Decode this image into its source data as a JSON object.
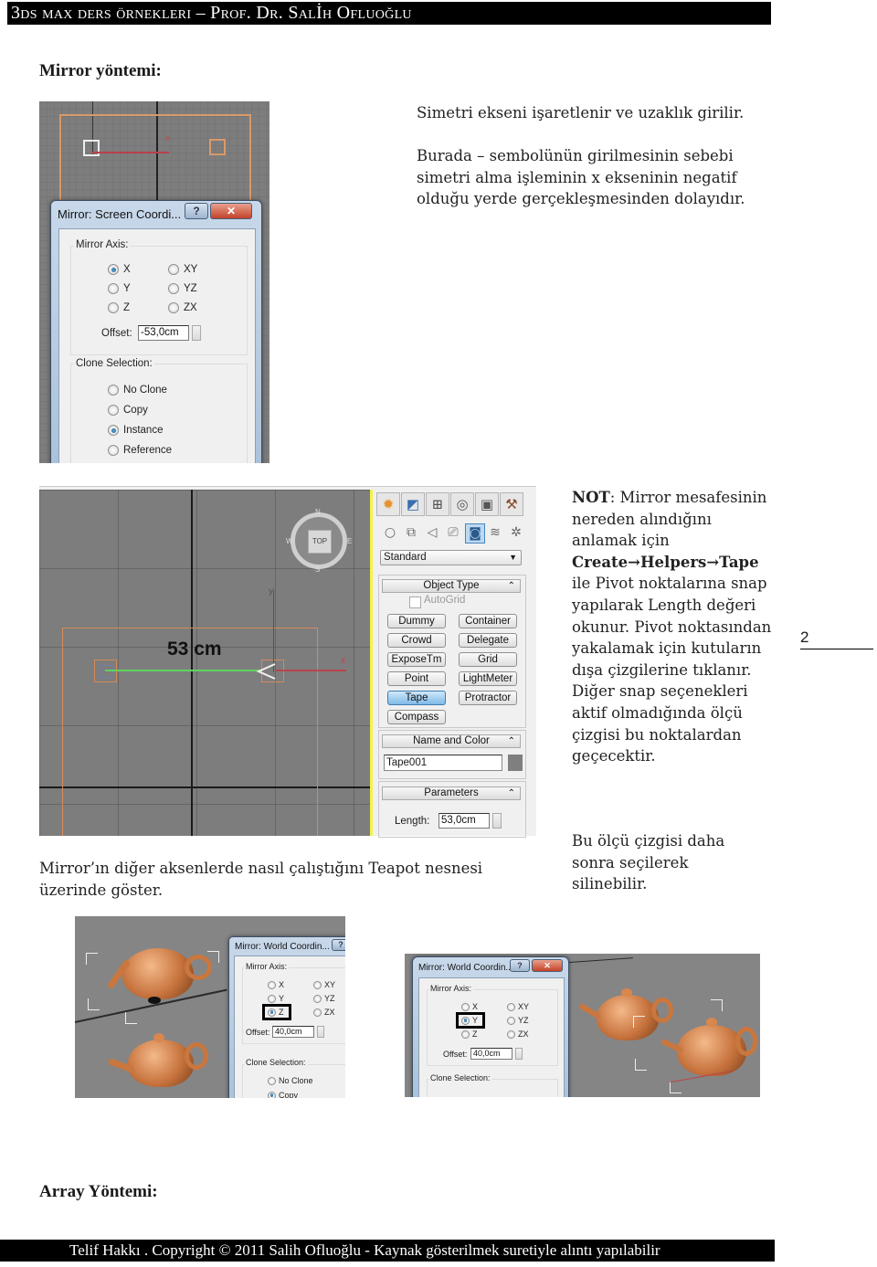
{
  "header": {
    "title": "3ds max ders örnekleri – Prof. Dr. Salİh Ofluoğlu"
  },
  "sections": {
    "mirror_title": "Mirror yöntemi:",
    "array_title": "Array Yöntemi:"
  },
  "intro_text": {
    "line1": "Simetri ekseni işaretlenir ve uzaklık girilir.",
    "para2": "Burada – sembolünün girilmesinin sebebi simetri alma işleminin x ekseninin negatif olduğu yerde gerçekleşmesinden dolayıdır."
  },
  "dialog1": {
    "title": "Mirror: Screen Coordi...",
    "help_btn": "?",
    "close_btn": "✕",
    "mirror_axis_label": "Mirror Axis:",
    "axes": [
      {
        "label": "X",
        "selected": true
      },
      {
        "label": "XY",
        "selected": false
      },
      {
        "label": "Y",
        "selected": false
      },
      {
        "label": "YZ",
        "selected": false
      },
      {
        "label": "Z",
        "selected": false
      },
      {
        "label": "ZX",
        "selected": false
      }
    ],
    "offset_label": "Offset:",
    "offset_value": "-53,0cm",
    "clone_label": "Clone Selection:",
    "clone_options": [
      {
        "label": "No Clone",
        "selected": false
      },
      {
        "label": "Copy",
        "selected": false
      },
      {
        "label": "Instance",
        "selected": true
      },
      {
        "label": "Reference",
        "selected": false
      }
    ]
  },
  "viewport2": {
    "measure_label": "53 cm",
    "viewcube_label": "TOP",
    "compass": {
      "n": "N",
      "s": "S",
      "e": "E",
      "w": "W"
    },
    "axis_x": "x",
    "axis_y": "y"
  },
  "command_panel": {
    "tabs": [
      "create-icon",
      "modify-icon",
      "hierarchy-icon",
      "motion-icon",
      "display-icon",
      "utilities-icon"
    ],
    "subcategories": [
      "geometry-icon",
      "shapes-icon",
      "lights-icon",
      "cameras-icon",
      "helpers-icon",
      "spacewarps-icon",
      "systems-icon"
    ],
    "dropdown_value": "Standard",
    "object_type_label": "Object Type",
    "autogrid_label": "AutoGrid",
    "buttons": [
      {
        "label": "Dummy",
        "active": false
      },
      {
        "label": "Container",
        "active": false
      },
      {
        "label": "Crowd",
        "active": false
      },
      {
        "label": "Delegate",
        "active": false
      },
      {
        "label": "ExposeTm",
        "active": false
      },
      {
        "label": "Grid",
        "active": false
      },
      {
        "label": "Point",
        "active": false
      },
      {
        "label": "LightMeter",
        "active": false
      },
      {
        "label": "Tape",
        "active": true
      },
      {
        "label": "Protractor",
        "active": false
      },
      {
        "label": "Compass",
        "active": false
      }
    ],
    "name_color_label": "Name and Color",
    "name_value": "Tape001",
    "color_swatch": "#7f7f7f",
    "parameters_label": "Parameters",
    "length_label": "Length:",
    "length_value": "53,0cm"
  },
  "note": {
    "bold_prefix": "NOT",
    "text_after_prefix": ": Mirror mesafesinin nereden alındığını anlamak için ",
    "bold_path": "Create→Helpers→Tape",
    "text_rest": " ile Pivot noktalarına snap yapılarak Length değeri okunur. Pivot noktasından yakalamak için kutuların dışa çizgilerine tıklanır. Diğer snap seçenekleri aktif olmadığında ölçü çizgisi bu noktalardan geçecektir.",
    "para2": "Bu ölçü çizgisi daha sonra seçilerek silinebilir."
  },
  "page_number": "2",
  "teapot_caption": "Mirror’ın diğer aksenlerde nasıl çalıştığını Teapot nesnesi üzerinde göster.",
  "dialog3": {
    "title": "Mirror: World Coordin...",
    "help_btn": "?",
    "mirror_axis_label": "Mirror Axis:",
    "axes": [
      {
        "label": "X",
        "selected": false
      },
      {
        "label": "XY",
        "selected": false
      },
      {
        "label": "Y",
        "selected": false
      },
      {
        "label": "YZ",
        "selected": false
      },
      {
        "label": "Z",
        "selected": true
      },
      {
        "label": "ZX",
        "selected": false
      }
    ],
    "offset_label": "Offset:",
    "offset_value": "40,0cm",
    "clone_label": "Clone Selection:",
    "clone_options": [
      {
        "label": "No Clone",
        "selected": false
      },
      {
        "label": "Copy",
        "selected": true
      }
    ]
  },
  "dialog4": {
    "title": "Mirror: World Coordin...",
    "help_btn": "?",
    "close_btn": "✕",
    "mirror_axis_label": "Mirror Axis:",
    "axes": [
      {
        "label": "X",
        "selected": false
      },
      {
        "label": "XY",
        "selected": false
      },
      {
        "label": "Y",
        "selected": true
      },
      {
        "label": "YZ",
        "selected": false
      },
      {
        "label": "Z",
        "selected": false
      },
      {
        "label": "ZX",
        "selected": false
      }
    ],
    "offset_label": "Offset:",
    "offset_value": "40,0cm",
    "clone_label": "Clone Selection:"
  },
  "footer": {
    "text": "Telif Hakkı . Copyright © 2011 Salih Ofluoğlu - Kaynak gösterilmek suretiyle alıntı yapılabilir"
  },
  "colors": {
    "selection_orange": "#e0935a",
    "axis_red": "#c0404a",
    "tape_green": "#5fd35f",
    "viewport_gray": "#7d7d7d",
    "active_border_yellow": "#f4f24a"
  }
}
